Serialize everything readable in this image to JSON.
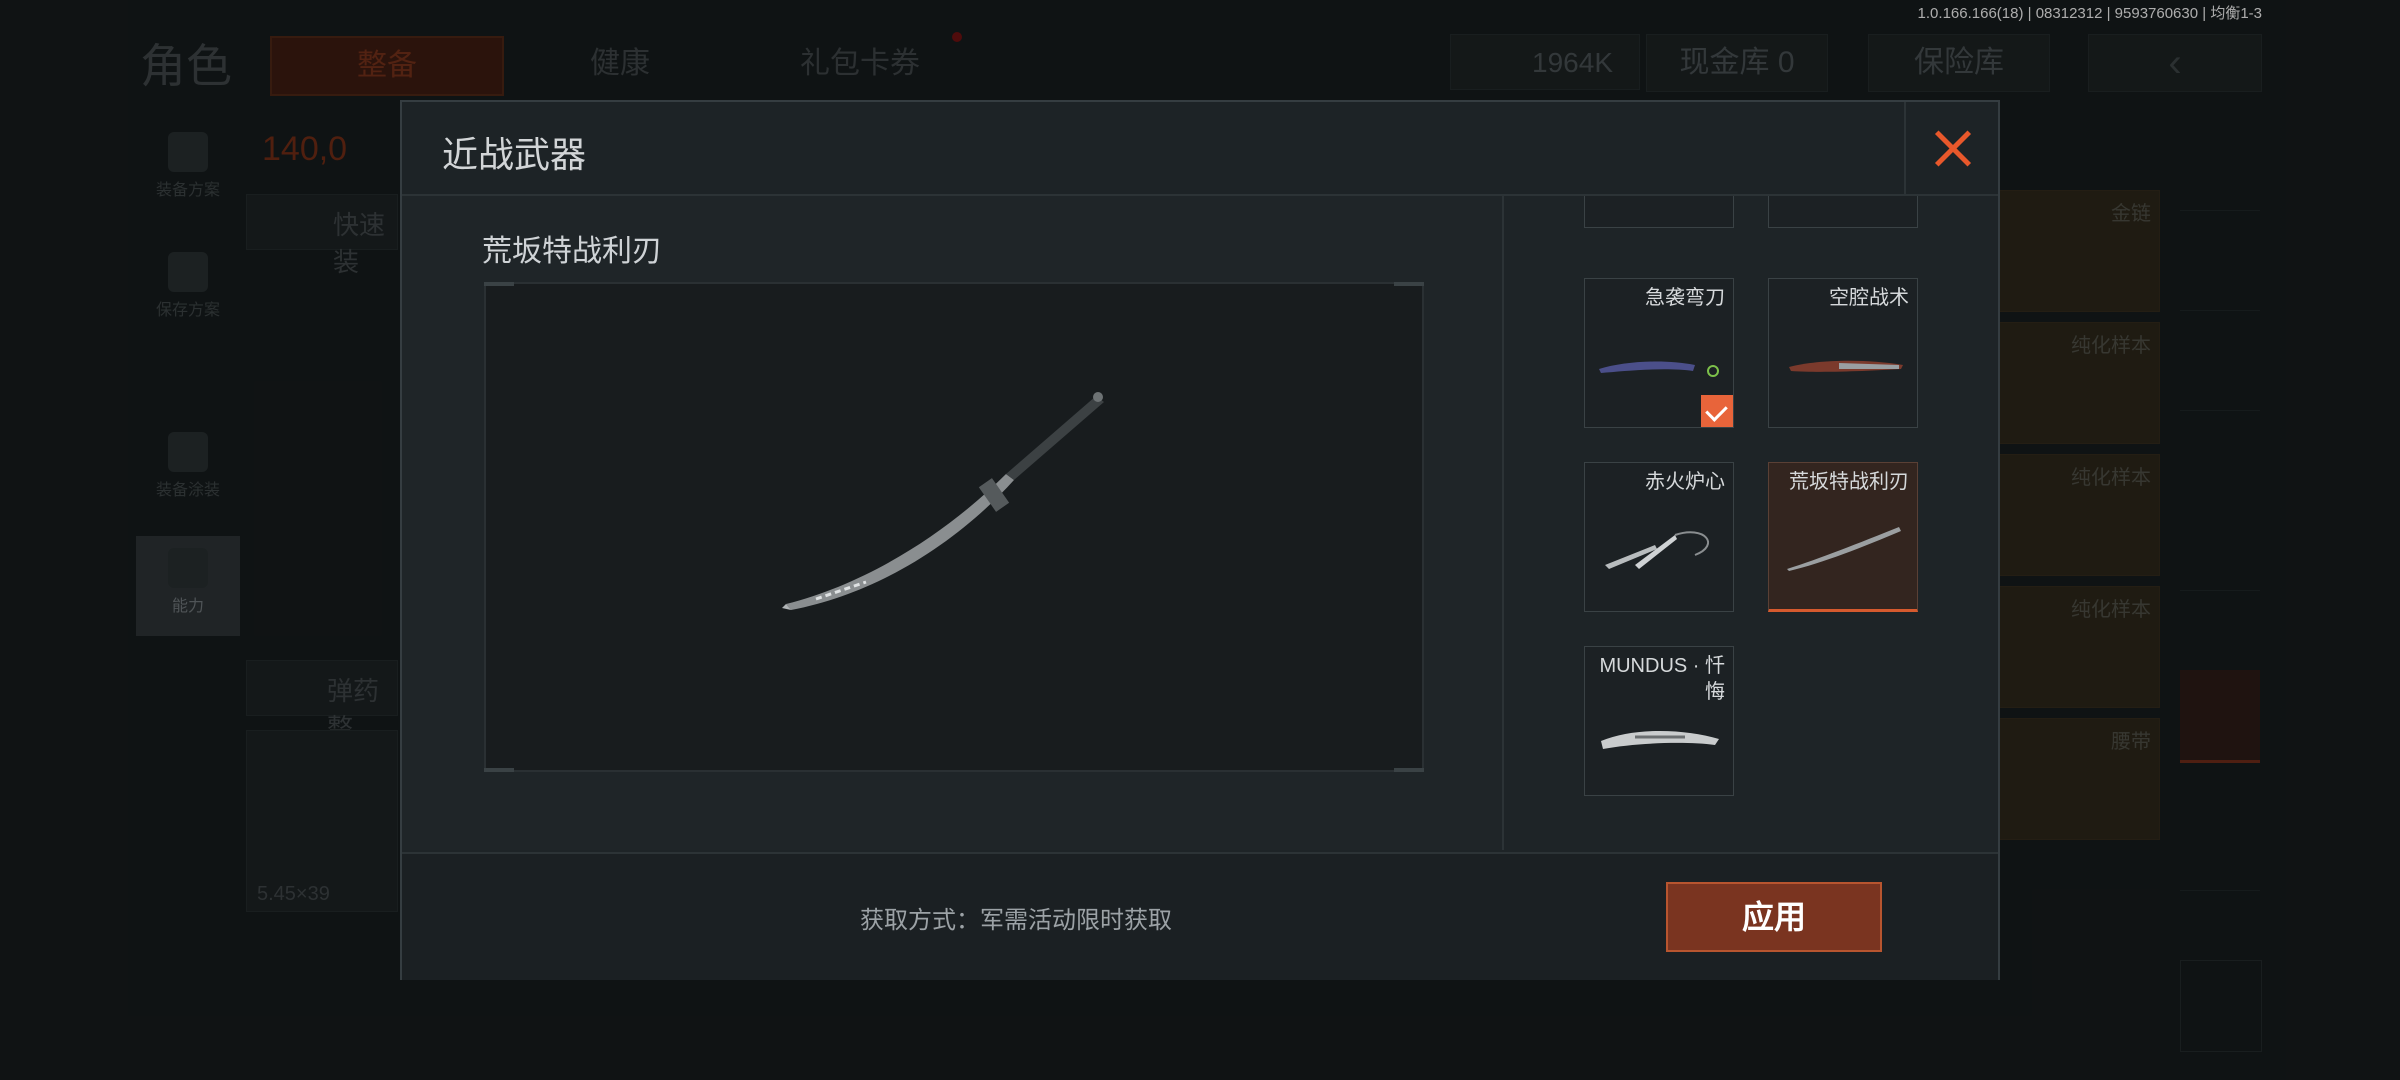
{
  "version_text": "1.0.166.166(18) | 08312312 | 9593760630 | 均衡1-3",
  "background": {
    "role_title": "角色",
    "tabs": [
      "整备",
      "健康",
      "礼包卡券"
    ],
    "money": "1964K",
    "vault": "现金库 0",
    "safe": "保险库",
    "left_nav": [
      "装备方案",
      "保存方案",
      "装备涂装",
      "能力"
    ],
    "orange_value": "140,0",
    "quick_label": "快速装",
    "ammo_label": "弹药整",
    "ammo_caliber": "5.45×39",
    "right_cards": [
      "金链",
      "纯化样本",
      "纯化样本",
      "纯化样本",
      "腰带"
    ]
  },
  "modal": {
    "title": "近战武器",
    "selected_item_name": "荒坂特战利刃",
    "acquire_text": "获取方式：军需活动限时获取",
    "apply_label": "应用",
    "items": [
      {
        "label": "急袭弯刀",
        "equipped": true,
        "selected": false
      },
      {
        "label": "空腔战术",
        "equipped": false,
        "selected": false
      },
      {
        "label": "赤火炉心",
        "equipped": false,
        "selected": false
      },
      {
        "label": "荒坂特战利刃",
        "equipped": false,
        "selected": true
      },
      {
        "label": "MUNDUS · 忏悔",
        "equipped": false,
        "selected": false
      }
    ]
  },
  "colors": {
    "accent": "#e8582b",
    "apply_bg": "#7a3420"
  }
}
